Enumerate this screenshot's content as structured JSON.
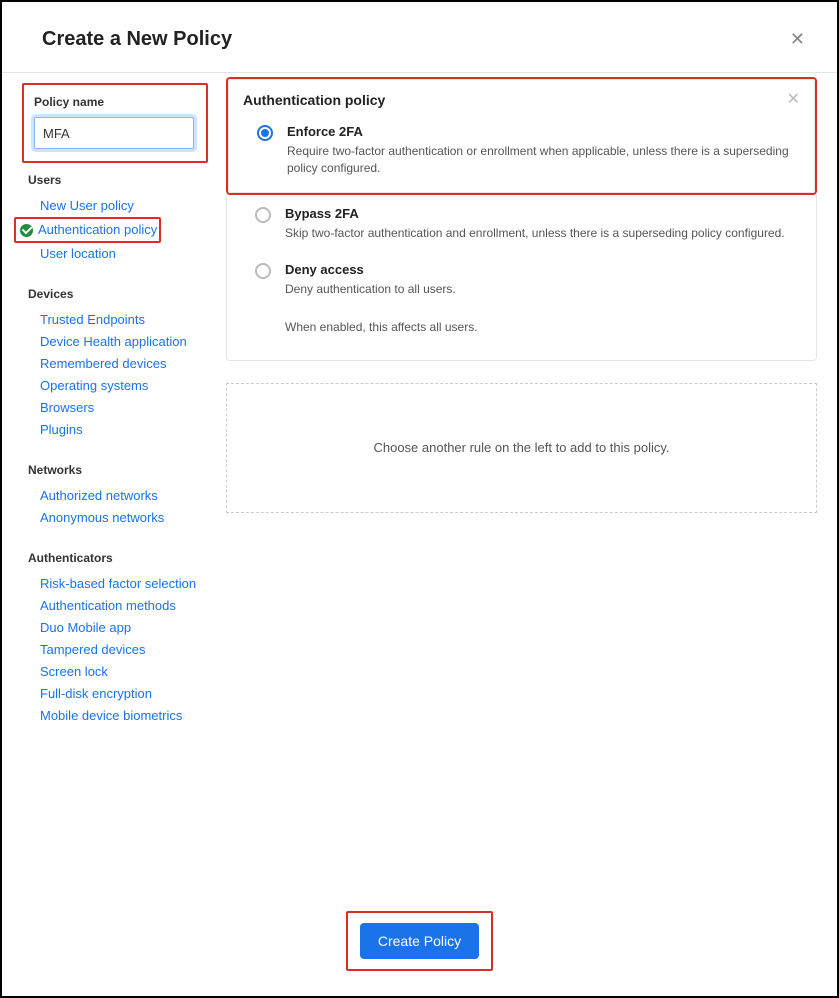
{
  "header": {
    "title": "Create a New Policy"
  },
  "sidebar": {
    "policy_name_label": "Policy name",
    "policy_name_value": "MFA",
    "groups": {
      "users": {
        "label": "Users",
        "items": [
          "New User policy",
          "Authentication policy",
          "User location"
        ]
      },
      "devices": {
        "label": "Devices",
        "items": [
          "Trusted Endpoints",
          "Device Health application",
          "Remembered devices",
          "Operating systems",
          "Browsers",
          "Plugins"
        ]
      },
      "networks": {
        "label": "Networks",
        "items": [
          "Authorized networks",
          "Anonymous networks"
        ]
      },
      "authenticators": {
        "label": "Authenticators",
        "items": [
          "Risk-based factor selection",
          "Authentication methods",
          "Duo Mobile app",
          "Tampered devices",
          "Screen lock",
          "Full-disk encryption",
          "Mobile device biometrics"
        ]
      }
    }
  },
  "panel": {
    "title": "Authentication policy",
    "options": [
      {
        "title": "Enforce 2FA",
        "desc": "Require two-factor authentication or enrollment when applicable, unless there is a superseding policy configured."
      },
      {
        "title": "Bypass 2FA",
        "desc": "Skip two-factor authentication and enrollment, unless there is a superseding policy configured."
      },
      {
        "title": "Deny access",
        "desc": "Deny authentication to all users."
      }
    ],
    "note": "When enabled, this affects all users."
  },
  "placeholder_text": "Choose another rule on the left to add to this policy.",
  "footer": {
    "button": "Create Policy"
  }
}
